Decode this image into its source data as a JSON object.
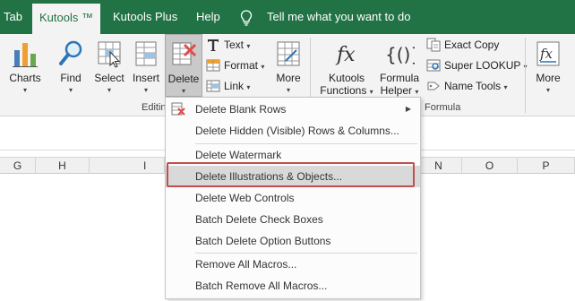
{
  "tabs": [
    {
      "label": "Tab",
      "active": false
    },
    {
      "label": "Kutools ™",
      "active": true
    },
    {
      "label": "Kutools Plus",
      "active": false
    },
    {
      "label": "Help",
      "active": false
    }
  ],
  "tell_me": {
    "text": "Tell me what you want to do",
    "icon": "lightbulb-icon"
  },
  "ribbon": {
    "charts": {
      "label": "Charts",
      "icon": "bar-chart-icon"
    },
    "find": {
      "label": "Find",
      "icon": "magnifier-icon"
    },
    "select": {
      "label": "Select",
      "icon": "select-cursor-icon"
    },
    "insert": {
      "label": "Insert",
      "icon": "insert-table-icon"
    },
    "delete": {
      "label": "Delete",
      "icon": "delete-grid-icon"
    },
    "text": {
      "label": "Text",
      "icon": "text-T-icon"
    },
    "format": {
      "label": "Format",
      "icon": "format-icon"
    },
    "link": {
      "label": "Link",
      "icon": "link-icon"
    },
    "more1": {
      "label": "More",
      "icon": "more-grid-icon"
    },
    "kutools_functions": {
      "label_1": "Kutools",
      "label_2": "Functions",
      "icon": "fx-icon"
    },
    "formula_helper": {
      "label_1": "Formula",
      "label_2": "Helper",
      "icon": "braces-icon"
    },
    "exact_copy": {
      "label": "Exact Copy",
      "icon": "exact-copy-icon"
    },
    "super_lookup": {
      "label": "Super LOOKUP",
      "icon": "lookup-icon"
    },
    "name_tools": {
      "label": "Name Tools",
      "icon": "name-tools-icon"
    },
    "more2": {
      "label": "More",
      "icon": "fx-more-icon"
    },
    "group_editing": "Editin",
    "group_formula": "Formula"
  },
  "columns": [
    "G",
    "H",
    "I",
    "N",
    "O",
    "P"
  ],
  "menu": {
    "items": [
      {
        "label": "Delete Blank Rows",
        "icon": "delete-rows-icon",
        "submenu": true
      },
      {
        "label": "Delete Hidden (Visible) Rows & Columns..."
      },
      {
        "label": "Delete Watermark"
      },
      {
        "label": "Delete Illustrations & Objects...",
        "highlighted": true
      },
      {
        "label": "Delete Web Controls"
      },
      {
        "label": "Batch Delete Check Boxes"
      },
      {
        "label": "Batch Delete Option Buttons"
      },
      {
        "label": "Remove All Macros..."
      },
      {
        "label": "Batch Remove All Macros..."
      }
    ]
  },
  "colors": {
    "brand_green": "#217346",
    "highlight_border": "#c0504d",
    "delete_red": "#e04b4b"
  }
}
